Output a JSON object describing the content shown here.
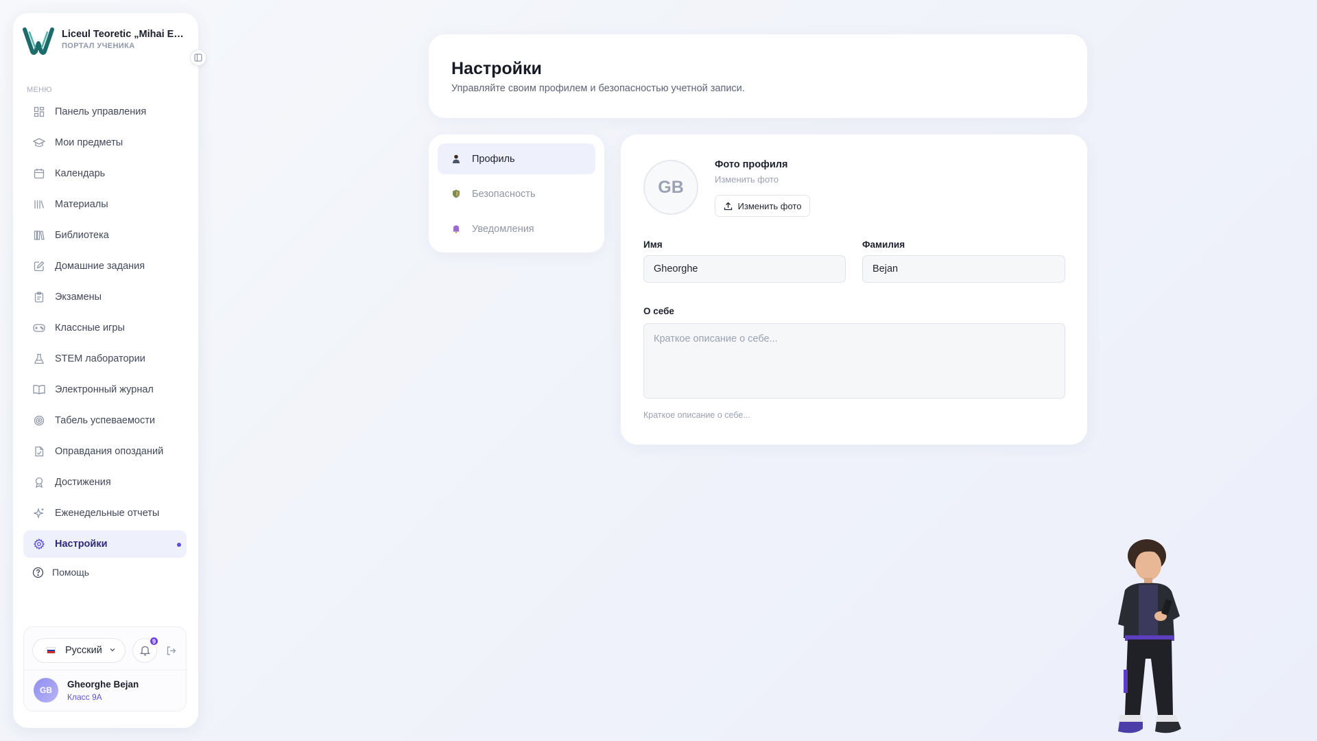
{
  "sidebar": {
    "brand_name": "Liceul Teoretic „Mihai Emi...",
    "brand_sub": "ПОРТАЛ УЧЕНИКА",
    "menu_label": "МЕНЮ",
    "items": [
      {
        "label": "Панель управления",
        "icon": "dashboard-icon"
      },
      {
        "label": "Мои предметы",
        "icon": "graduation-cap-icon"
      },
      {
        "label": "Календарь",
        "icon": "calendar-icon"
      },
      {
        "label": "Материалы",
        "icon": "library-icon"
      },
      {
        "label": "Библиотека",
        "icon": "books-icon"
      },
      {
        "label": "Домашние задания",
        "icon": "edit-square-icon"
      },
      {
        "label": "Экзамены",
        "icon": "clipboard-icon"
      },
      {
        "label": "Классные игры",
        "icon": "gamepad-icon"
      },
      {
        "label": "STEM лаборатории",
        "icon": "flask-icon"
      },
      {
        "label": "Электронный журнал",
        "icon": "open-book-icon"
      },
      {
        "label": "Табель успеваемости",
        "icon": "target-icon"
      },
      {
        "label": "Оправдания опозданий",
        "icon": "file-check-icon"
      },
      {
        "label": "Достижения",
        "icon": "award-icon"
      },
      {
        "label": "Еженедельные отчеты",
        "icon": "sparkles-icon"
      },
      {
        "label": "Настройки",
        "icon": "gear-icon",
        "active": true
      }
    ],
    "help_label": "Помощь",
    "language": "Русский",
    "notifications_count": "9",
    "user_name": "Gheorghe Bejan",
    "user_class": "Класс 9А",
    "user_initials": "GB"
  },
  "header": {
    "title": "Настройки",
    "subtitle": "Управляйте своим профилем и безопасностью учетной записи."
  },
  "tabs": [
    {
      "label": "Профиль",
      "icon": "person-icon",
      "active": true
    },
    {
      "label": "Безопасность",
      "icon": "shield-icon",
      "active": false
    },
    {
      "label": "Уведомления",
      "icon": "bell-icon",
      "active": false
    }
  ],
  "profile": {
    "avatar_initials": "GB",
    "photo_title": "Фото профиля",
    "photo_sub": "Изменить фото",
    "photo_button": "Изменить фото",
    "first_name_label": "Имя",
    "first_name_value": "Gheorghe",
    "last_name_label": "Фамилия",
    "last_name_value": "Bejan",
    "about_label": "О себе",
    "about_placeholder": "Краткое описание о себе...",
    "about_hint": "Краткое описание о себе..."
  },
  "colors": {
    "accent": "#5b4fd8",
    "active_bg": "#eef0fc",
    "badge": "#6d3ee0"
  }
}
